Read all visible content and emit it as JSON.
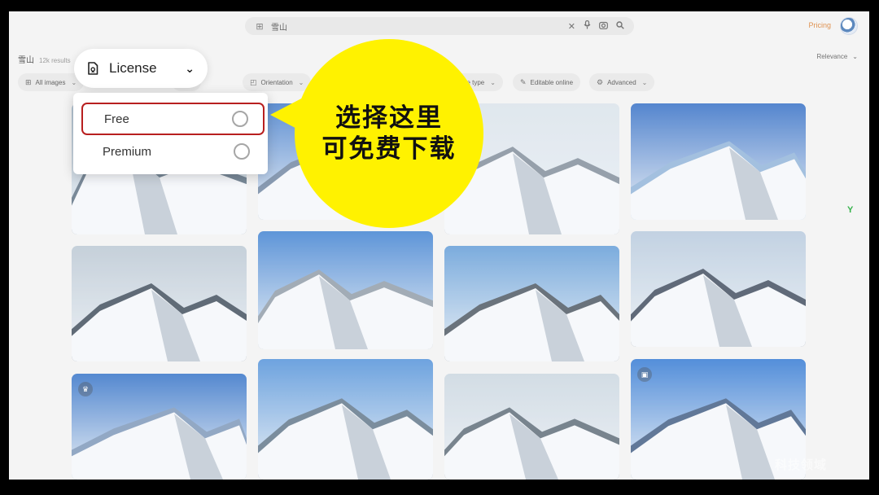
{
  "search": {
    "query": "雪山",
    "icons": [
      "grid-search-icon",
      "clear-icon",
      "mic-icon",
      "camera-icon",
      "search-icon"
    ]
  },
  "header": {
    "pricing": "Pricing"
  },
  "results": {
    "title": "雪山",
    "count": "12k results",
    "sort": "Relevance"
  },
  "filters": [
    {
      "label": "All images",
      "icon": "grid-icon"
    },
    {
      "label": "Orientation",
      "icon": "orientation-icon"
    },
    {
      "label": "File type",
      "icon": "file-icon"
    },
    {
      "label": "Editable online",
      "icon": "pencil-icon"
    },
    {
      "label": "Advanced",
      "icon": "gear-icon"
    }
  ],
  "license": {
    "label": "License",
    "options": [
      {
        "label": "Free",
        "selected": false,
        "highlighted": true
      },
      {
        "label": "Premium",
        "selected": false,
        "highlighted": false
      }
    ]
  },
  "callout": {
    "line1": "选择这里",
    "line2": "可免费下载"
  },
  "colors": {
    "callout": "#fff200",
    "highlight": "#b81f1f",
    "pricing": "#d87a2a"
  }
}
